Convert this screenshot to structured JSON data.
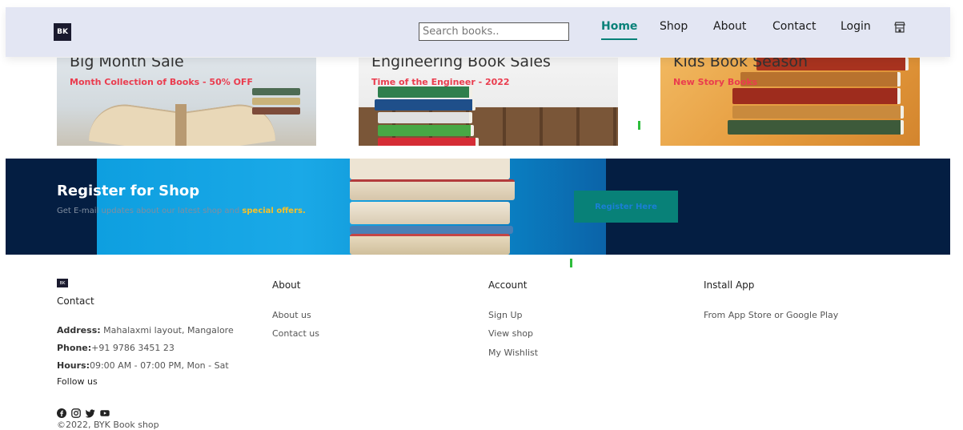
{
  "navbar": {
    "logo_text": "BK",
    "search_placeholder": "Search books..",
    "links": [
      "Home",
      "Shop",
      "About",
      "Contact",
      "Login"
    ],
    "active_link": "Home",
    "cart_icon": "shop-icon",
    "accent_color": "#088178",
    "background_color": "#e3e6f3"
  },
  "banners": [
    {
      "title": "Big Month Sale",
      "subtitle": "Month Collection of Books - 50% OFF"
    },
    {
      "title": "Engineering Book Sales",
      "subtitle": "Time of the Engineer - 2022"
    },
    {
      "title": "Kids Book Season",
      "subtitle": "New Story Books"
    }
  ],
  "register": {
    "title": "Register for Shop",
    "text": "Get E-mail updates about our latest shop and",
    "highlight": "special offers.",
    "button_label": "Register Here",
    "background_color": "#041e42",
    "highlight_color": "#f6c028"
  },
  "footer": {
    "logo_text": "BK",
    "contact_heading": "Contact",
    "address_label": "Address:",
    "address_value": "Mahalaxmi layout, Mangalore",
    "phone_label": "Phone:",
    "phone_value": "+91 9786 3451 23",
    "hours_label": "Hours:",
    "hours_value": "09:00 AM - 07:00 PM, Mon - Sat",
    "follow_label": "Follow us",
    "social_icons": [
      "facebook-icon",
      "instagram-icon",
      "twitter-icon",
      "youtube-icon"
    ],
    "about_heading": "About",
    "about_links": [
      "About us",
      "Contact us"
    ],
    "account_heading": "Account",
    "account_links": [
      "Sign Up",
      "View shop",
      "My Wishlist"
    ],
    "app_heading": "Install App",
    "app_text": "From App Store or Google Play",
    "copyright": "©2022, BYK Book shop"
  }
}
